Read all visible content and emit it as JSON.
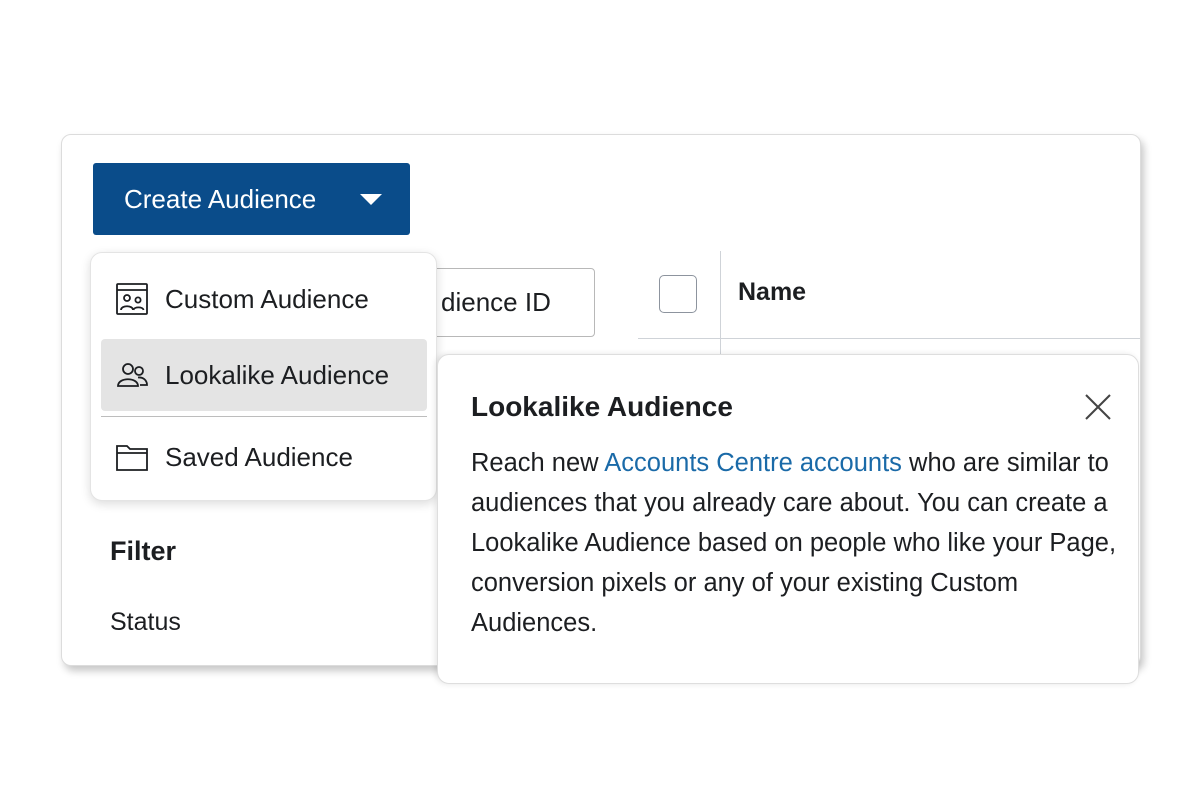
{
  "create_button": {
    "label": "Create Audience"
  },
  "dropdown": {
    "items": [
      {
        "label": "Custom Audience",
        "icon": "custom-audience-icon"
      },
      {
        "label": "Lookalike Audience",
        "icon": "people-icon"
      },
      {
        "label": "Saved Audience",
        "icon": "folder-icon"
      }
    ]
  },
  "search": {
    "value": "dience ID"
  },
  "table": {
    "columns": [
      "Name"
    ]
  },
  "filter": {
    "title": "Filter",
    "status_label": "Status"
  },
  "popover": {
    "title": "Lookalike Audience",
    "text_before_link": "Reach new ",
    "link_text": "Accounts Centre accounts",
    "text_after_link": " who are similar to audiences that you already care about. You can create a Lookalike Audience based on people who like your Page, conversion pixels or any of your existing Custom Audiences."
  },
  "colors": {
    "primary_button": "#0a4c8a",
    "link": "#1a6aa8",
    "highlight": "#e4e4e4"
  }
}
